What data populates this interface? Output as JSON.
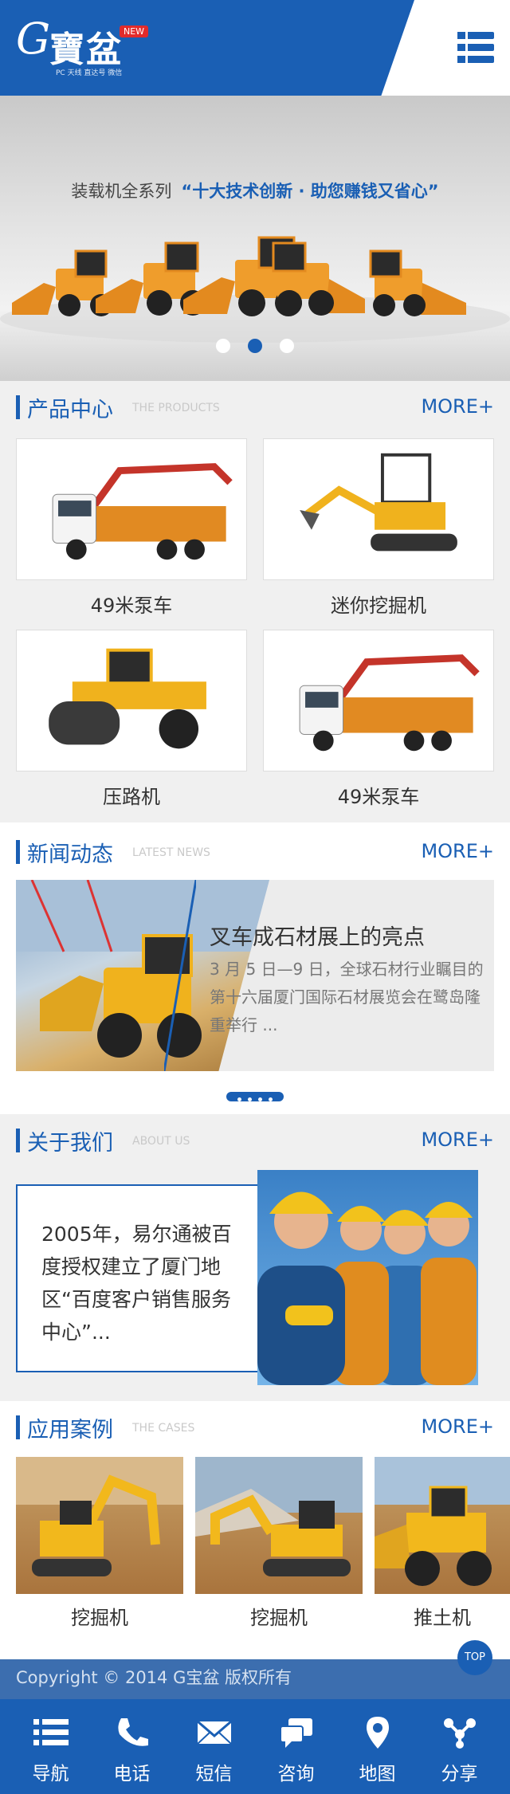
{
  "header": {
    "logo_letter": "G",
    "logo_name": "寶盆",
    "logo_badge": "NEW",
    "logo_sub": "PC 天线  直达号  微信"
  },
  "banner": {
    "slogan_left": "装载机全系列",
    "slogan_right": "“十大技术创新 · 助您赚钱又省心”",
    "slides": 3,
    "active_slide": 2
  },
  "products": {
    "title": "产品中心",
    "subtitle": "THE PRODUCTS",
    "more": "MORE+",
    "items": [
      {
        "label": "49米泵车"
      },
      {
        "label": "迷你挖掘机"
      },
      {
        "label": "压路机"
      },
      {
        "label": "49米泵车"
      }
    ]
  },
  "news": {
    "title": "新闻动态",
    "subtitle": "LATEST NEWS",
    "more": "MORE+",
    "headline": "叉车成石材展上的亮点",
    "summary": "3 月 5 日—9 日，全球石材行业瞩目的第十六届厦门国际石材展览会在鹭岛隆重举行 ..."
  },
  "about": {
    "title": "关于我们",
    "subtitle": "ABOUT US",
    "more": "MORE+",
    "text": "2005年，易尔通被百度授权建立了厦门地区“百度客户销售服务中心”..."
  },
  "cases": {
    "title": "应用案例",
    "subtitle": "THE CASES",
    "more": "MORE+",
    "items": [
      {
        "label": "挖掘机"
      },
      {
        "label": "挖掘机"
      },
      {
        "label": "推土机"
      }
    ]
  },
  "footer": {
    "copyright": "Copyright © 2014 G宝盆 版权所有",
    "top": "TOP"
  },
  "nav": {
    "items": [
      {
        "label": "导航",
        "icon": "list-icon"
      },
      {
        "label": "电话",
        "icon": "phone-icon"
      },
      {
        "label": "短信",
        "icon": "envelope-icon"
      },
      {
        "label": "咨询",
        "icon": "chat-icon"
      },
      {
        "label": "地图",
        "icon": "map-pin-icon"
      },
      {
        "label": "分享",
        "icon": "share-icon"
      }
    ]
  },
  "colors": {
    "brand_blue": "#1a5fb4",
    "footer_blue": "#3c6eaf"
  }
}
